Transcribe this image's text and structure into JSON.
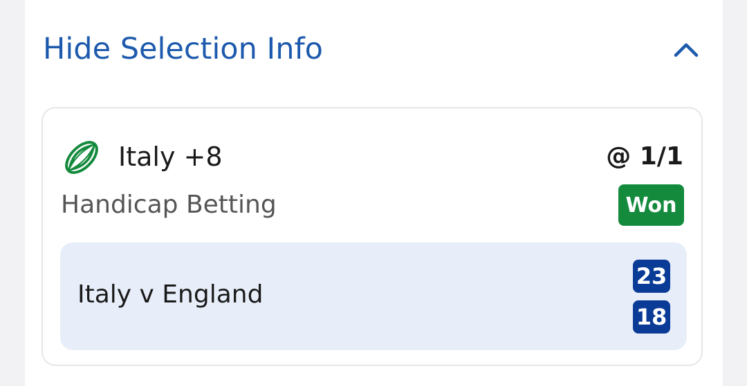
{
  "header": {
    "toggle_label": "Hide Selection Info",
    "chevron_icon": "chevron-up-icon"
  },
  "selection": {
    "sport_icon": "rugby-ball-icon",
    "name": "Italy +8",
    "odds": "@ 1/1",
    "market": "Handicap Betting",
    "result": "Won",
    "result_color": "#138a3c"
  },
  "event": {
    "name": "Italy v England",
    "scores": [
      "23",
      "18"
    ],
    "score_color": "#0a3b96"
  },
  "colors": {
    "accent": "#1d5aad",
    "event_background": "#e8eef9",
    "icon_green": "#138a3c"
  }
}
